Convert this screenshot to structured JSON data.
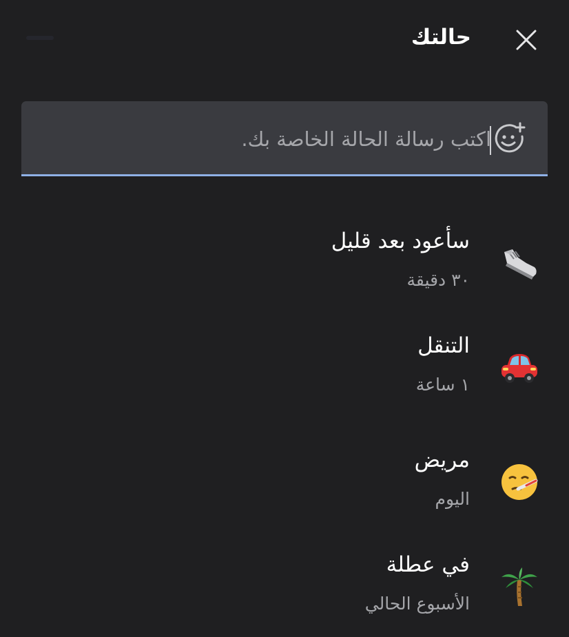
{
  "header": {
    "title": "حالتك"
  },
  "input": {
    "placeholder": "اكتب رسالة الحالة الخاصة بك.",
    "value": ""
  },
  "statuses": [
    {
      "label": "سأعود بعد قليل",
      "duration": "٣٠ دقيقة",
      "icon": "sneaker-icon"
    },
    {
      "label": "التنقل",
      "duration": "١ ساعة",
      "icon": "car-icon"
    },
    {
      "label": "مريض",
      "duration": "اليوم",
      "icon": "sick-face-icon"
    },
    {
      "label": "في عطلة",
      "duration": "الأسبوع الحالي",
      "icon": "palm-tree-icon"
    }
  ],
  "colors": {
    "background": "#1f1f21",
    "input_background": "#3a3b40",
    "input_underline": "#8fb1e6",
    "secondary_text": "#a5a6aa"
  }
}
